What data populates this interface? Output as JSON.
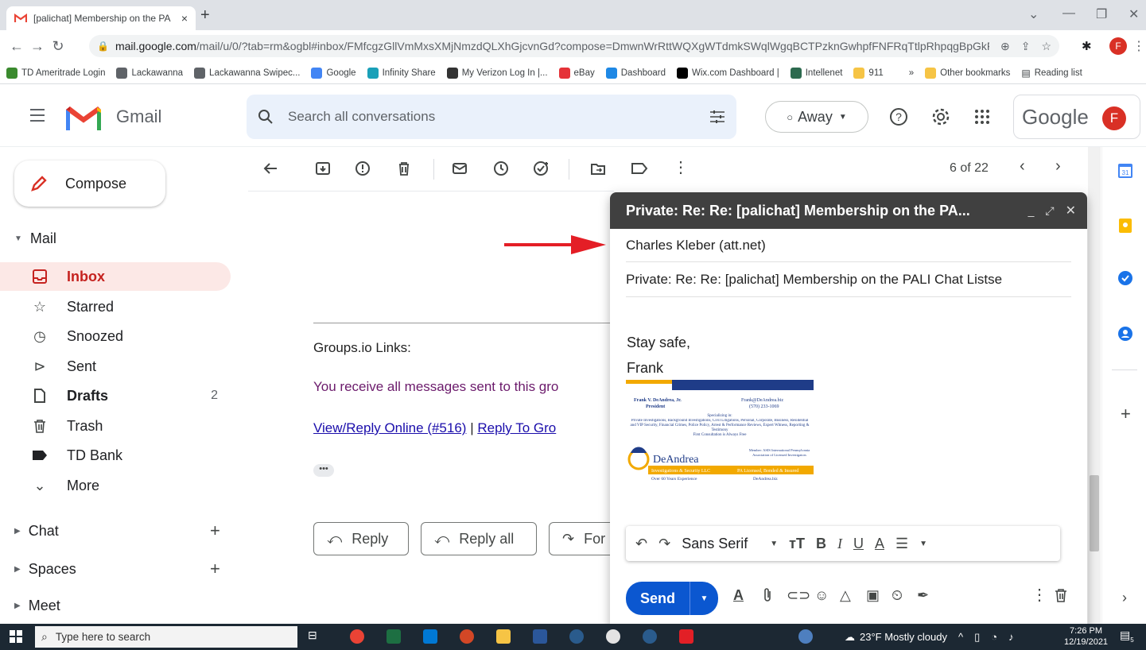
{
  "browser": {
    "tab_title": "[palichat] Membership on the PA",
    "tab_close": "×",
    "new_tab": "+",
    "url_host": "mail.google.com",
    "url_rest": "/mail/u/0/?tab=rm&ogbl#inbox/FMfcgzGllVmMxsXMjNmzdQLXhGjcvnGd?compose=DmwnWrRttWQXgWTdmkSWqlWgqBCTPzknGwhpfFNFRqTtlpRhpqgBpGkFVxGFvgHFqrs...",
    "profile_letter": "F",
    "bookmarks": [
      {
        "label": "TD Ameritrade Login",
        "color": "#3a8a2e"
      },
      {
        "label": "Lackawanna",
        "color": "#5f6368"
      },
      {
        "label": "Lackawanna Swipec...",
        "color": "#5f6368"
      },
      {
        "label": "Google",
        "color": "#4285f4"
      },
      {
        "label": "Infinity Share",
        "color": "#1aa0b8"
      },
      {
        "label": "My Verizon Log In |...",
        "color": "#333333"
      },
      {
        "label": "eBay",
        "color": "#e53238"
      },
      {
        "label": "Dashboard",
        "color": "#1e88e5"
      },
      {
        "label": "Wix.com Dashboard |",
        "color": "#000000"
      },
      {
        "label": "Intellenet",
        "color": "#2d6a4f"
      },
      {
        "label": "911",
        "color": "#f6c445"
      }
    ],
    "bookmarks_more": "»",
    "other_bookmarks": "Other bookmarks",
    "reading_list": "Reading list"
  },
  "gmail": {
    "logo_text": "Gmail",
    "search_placeholder": "Search all conversations",
    "status": "Away",
    "google_text": "Google",
    "avatar_letter": "F",
    "compose_label": "Compose",
    "mail_section": "Mail",
    "nav": [
      {
        "label": "Inbox",
        "count": "",
        "icon": "inbox-icon"
      },
      {
        "label": "Starred",
        "count": "",
        "icon": "star-icon"
      },
      {
        "label": "Snoozed",
        "count": "",
        "icon": "clock-icon"
      },
      {
        "label": "Sent",
        "count": "",
        "icon": "send-icon"
      },
      {
        "label": "Drafts",
        "count": "2",
        "icon": "draft-icon"
      },
      {
        "label": "Trash",
        "count": "",
        "icon": "trash-icon"
      },
      {
        "label": "TD Bank",
        "count": "",
        "icon": "label-icon"
      },
      {
        "label": "More",
        "count": "",
        "icon": "chevron-down-icon"
      }
    ],
    "chat_section": "Chat",
    "spaces_section": "Spaces",
    "meet_section": "Meet",
    "pager": "6 of 22"
  },
  "email": {
    "groups_links": "Groups.io Links:",
    "receive_all": "You receive all messages sent to this gro",
    "view_reply": "View/Reply Online (#516)",
    "separator": " | ",
    "reply_to_group": "Reply To Gro",
    "reply": "Reply",
    "reply_all": "Reply all",
    "forward": "For"
  },
  "compose": {
    "title": "Private: Re: Re: [palichat] Membership on the PA...",
    "to": "Charles Kleber (att.net)",
    "subject": "Private: Re: Re: [palichat] Membership on the PALI Chat Listse",
    "body_line1": "Stay safe,",
    "body_line2": "Frank",
    "signature": {
      "name": "Frank V. DeAndrea, Jr.",
      "role": "President",
      "email": "Frank@DeAndrea.biz",
      "phone": "(570) 233-1069",
      "specializing": "Specializing in:",
      "services": "Private Investigations, Background Investigations, Civil Litigations, Personal, Corporate, Business, Residential and VIP Security, Financial Crimes, Police Policy, Arrest & Performance Reviews, Expert Witness, Reporting & Testimony",
      "consult": "First Consultation is Always Free",
      "brand": "DeAndrea",
      "members": "Member: ASIS International Pennsylvania Association of Licensed Investigators",
      "banner_left": "Investigations & Security LLC",
      "banner_right": "PA Licensed, Bonded & Insured",
      "experience": "Over 60 Years Experience",
      "website": "DeAndrea.biz"
    },
    "font_name": "Sans Serif",
    "send": "Send"
  },
  "taskbar": {
    "search_placeholder": "Type here to search",
    "weather": "23°F  Mostly cloudy",
    "time": "7:26 PM",
    "date": "12/19/2021",
    "notif_count": "5"
  },
  "colors": {
    "accent_red": "#d93025",
    "send_blue": "#0b57d0",
    "compose_header": "#404040",
    "arrow_red": "#e41e26"
  }
}
